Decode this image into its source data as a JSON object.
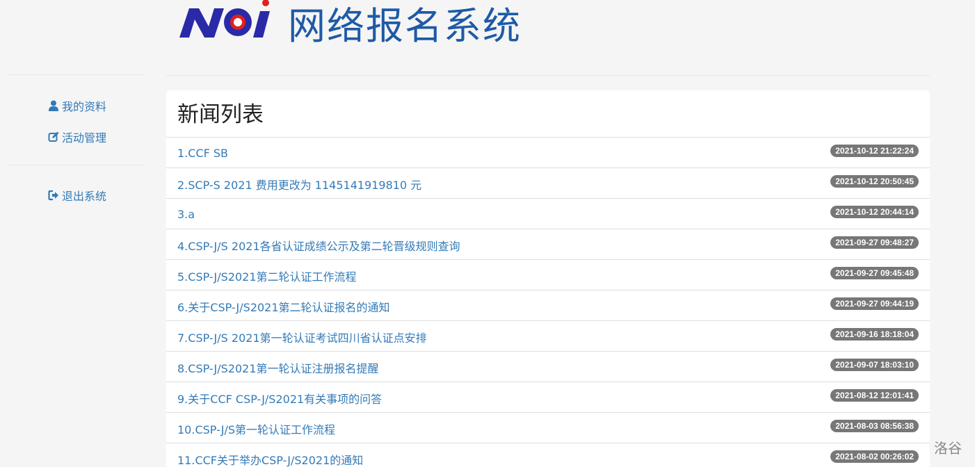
{
  "header": {
    "logo_text": "NOI",
    "site_title": "网络报名系统",
    "colors": {
      "logo_blue": "#2a2aa8",
      "logo_red": "#e02020",
      "title_blue": "#1e5aa6"
    }
  },
  "sidebar": {
    "items": [
      {
        "label": "我的资料",
        "icon": "user-icon"
      },
      {
        "label": "活动管理",
        "icon": "edit-icon"
      },
      {
        "label": "退出系统",
        "icon": "sign-out-icon"
      }
    ]
  },
  "news": {
    "title": "新闻列表",
    "items": [
      {
        "title": "1.CCF SB",
        "date": "2021-10-12 21:22:24"
      },
      {
        "title": "2.SCP-S 2021 费用更改为 1145141919810 元",
        "date": "2021-10-12 20:50:45"
      },
      {
        "title": "3.a",
        "date": "2021-10-12 20:44:14"
      },
      {
        "title": "4.CSP-J/S 2021各省认证成绩公示及第二轮晋级规则查询",
        "date": "2021-09-27 09:48:27"
      },
      {
        "title": "5.CSP-J/S2021第二轮认证工作流程",
        "date": "2021-09-27 09:45:48"
      },
      {
        "title": "6.关于CSP-J/S2021第二轮认证报名的通知",
        "date": "2021-09-27 09:44:19"
      },
      {
        "title": "7.CSP-J/S 2021第一轮认证考试四川省认证点安排",
        "date": "2021-09-16 18:18:04"
      },
      {
        "title": "8.CSP-J/S2021第一轮认证注册报名提醒",
        "date": "2021-09-07 18:03:10"
      },
      {
        "title": "9.关于CCF CSP-J/S2021有关事项的问答",
        "date": "2021-08-12 12:01:41"
      },
      {
        "title": "10.CSP-J/S第一轮认证工作流程",
        "date": "2021-08-03 08:56:38"
      },
      {
        "title": "11.CCF关于举办CSP-J/S2021的通知",
        "date": "2021-08-02 00:26:02"
      }
    ]
  },
  "watermark": "洛谷"
}
